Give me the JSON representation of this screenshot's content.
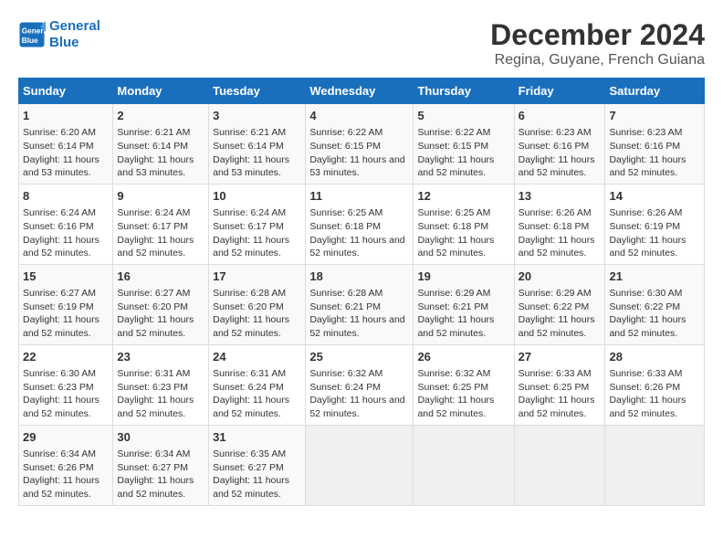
{
  "logo": {
    "line1": "General",
    "line2": "Blue"
  },
  "title": "December 2024",
  "subtitle": "Regina, Guyane, French Guiana",
  "headers": [
    "Sunday",
    "Monday",
    "Tuesday",
    "Wednesday",
    "Thursday",
    "Friday",
    "Saturday"
  ],
  "weeks": [
    [
      {
        "day": "1",
        "sunrise": "6:20 AM",
        "sunset": "6:14 PM",
        "daylight": "11 hours and 53 minutes."
      },
      {
        "day": "2",
        "sunrise": "6:21 AM",
        "sunset": "6:14 PM",
        "daylight": "11 hours and 53 minutes."
      },
      {
        "day": "3",
        "sunrise": "6:21 AM",
        "sunset": "6:14 PM",
        "daylight": "11 hours and 53 minutes."
      },
      {
        "day": "4",
        "sunrise": "6:22 AM",
        "sunset": "6:15 PM",
        "daylight": "11 hours and 53 minutes."
      },
      {
        "day": "5",
        "sunrise": "6:22 AM",
        "sunset": "6:15 PM",
        "daylight": "11 hours and 52 minutes."
      },
      {
        "day": "6",
        "sunrise": "6:23 AM",
        "sunset": "6:16 PM",
        "daylight": "11 hours and 52 minutes."
      },
      {
        "day": "7",
        "sunrise": "6:23 AM",
        "sunset": "6:16 PM",
        "daylight": "11 hours and 52 minutes."
      }
    ],
    [
      {
        "day": "8",
        "sunrise": "6:24 AM",
        "sunset": "6:16 PM",
        "daylight": "11 hours and 52 minutes."
      },
      {
        "day": "9",
        "sunrise": "6:24 AM",
        "sunset": "6:17 PM",
        "daylight": "11 hours and 52 minutes."
      },
      {
        "day": "10",
        "sunrise": "6:24 AM",
        "sunset": "6:17 PM",
        "daylight": "11 hours and 52 minutes."
      },
      {
        "day": "11",
        "sunrise": "6:25 AM",
        "sunset": "6:18 PM",
        "daylight": "11 hours and 52 minutes."
      },
      {
        "day": "12",
        "sunrise": "6:25 AM",
        "sunset": "6:18 PM",
        "daylight": "11 hours and 52 minutes."
      },
      {
        "day": "13",
        "sunrise": "6:26 AM",
        "sunset": "6:18 PM",
        "daylight": "11 hours and 52 minutes."
      },
      {
        "day": "14",
        "sunrise": "6:26 AM",
        "sunset": "6:19 PM",
        "daylight": "11 hours and 52 minutes."
      }
    ],
    [
      {
        "day": "15",
        "sunrise": "6:27 AM",
        "sunset": "6:19 PM",
        "daylight": "11 hours and 52 minutes."
      },
      {
        "day": "16",
        "sunrise": "6:27 AM",
        "sunset": "6:20 PM",
        "daylight": "11 hours and 52 minutes."
      },
      {
        "day": "17",
        "sunrise": "6:28 AM",
        "sunset": "6:20 PM",
        "daylight": "11 hours and 52 minutes."
      },
      {
        "day": "18",
        "sunrise": "6:28 AM",
        "sunset": "6:21 PM",
        "daylight": "11 hours and 52 minutes."
      },
      {
        "day": "19",
        "sunrise": "6:29 AM",
        "sunset": "6:21 PM",
        "daylight": "11 hours and 52 minutes."
      },
      {
        "day": "20",
        "sunrise": "6:29 AM",
        "sunset": "6:22 PM",
        "daylight": "11 hours and 52 minutes."
      },
      {
        "day": "21",
        "sunrise": "6:30 AM",
        "sunset": "6:22 PM",
        "daylight": "11 hours and 52 minutes."
      }
    ],
    [
      {
        "day": "22",
        "sunrise": "6:30 AM",
        "sunset": "6:23 PM",
        "daylight": "11 hours and 52 minutes."
      },
      {
        "day": "23",
        "sunrise": "6:31 AM",
        "sunset": "6:23 PM",
        "daylight": "11 hours and 52 minutes."
      },
      {
        "day": "24",
        "sunrise": "6:31 AM",
        "sunset": "6:24 PM",
        "daylight": "11 hours and 52 minutes."
      },
      {
        "day": "25",
        "sunrise": "6:32 AM",
        "sunset": "6:24 PM",
        "daylight": "11 hours and 52 minutes."
      },
      {
        "day": "26",
        "sunrise": "6:32 AM",
        "sunset": "6:25 PM",
        "daylight": "11 hours and 52 minutes."
      },
      {
        "day": "27",
        "sunrise": "6:33 AM",
        "sunset": "6:25 PM",
        "daylight": "11 hours and 52 minutes."
      },
      {
        "day": "28",
        "sunrise": "6:33 AM",
        "sunset": "6:26 PM",
        "daylight": "11 hours and 52 minutes."
      }
    ],
    [
      {
        "day": "29",
        "sunrise": "6:34 AM",
        "sunset": "6:26 PM",
        "daylight": "11 hours and 52 minutes."
      },
      {
        "day": "30",
        "sunrise": "6:34 AM",
        "sunset": "6:27 PM",
        "daylight": "11 hours and 52 minutes."
      },
      {
        "day": "31",
        "sunrise": "6:35 AM",
        "sunset": "6:27 PM",
        "daylight": "11 hours and 52 minutes."
      },
      null,
      null,
      null,
      null
    ]
  ],
  "labels": {
    "sunrise_prefix": "Sunrise: ",
    "sunset_prefix": "Sunset: ",
    "daylight_prefix": "Daylight: "
  }
}
